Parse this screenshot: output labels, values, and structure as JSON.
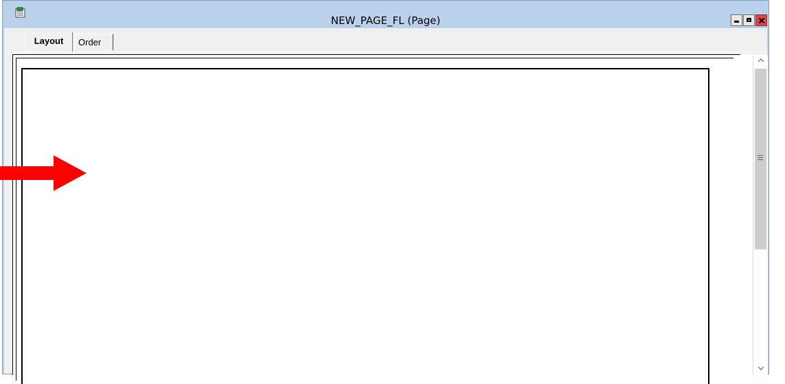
{
  "window": {
    "title": "NEW_PAGE_FL (Page)",
    "app_icon": "page-definition-icon",
    "controls": [
      "minimize-icon",
      "maximize-icon",
      "close-icon"
    ]
  },
  "tabs": [
    {
      "label": "Layout",
      "active": true
    },
    {
      "label": "Order",
      "active": false
    }
  ],
  "scrollbar": {
    "up_arrow": "^",
    "down_arrow": "v"
  },
  "annotation": {
    "icon": "red-arrow-icon",
    "color": "#ff0000"
  },
  "colors": {
    "titlebar": "#b9d1ea",
    "client_bg": "#f0f0f0",
    "close_button": "#e04343"
  }
}
